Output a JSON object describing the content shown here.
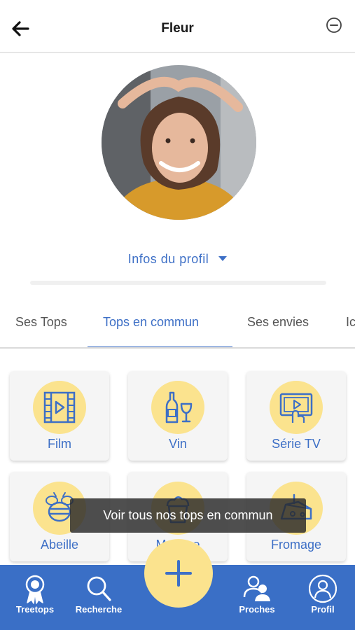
{
  "header": {
    "title": "Fleur",
    "back_icon": "arrow-left-icon",
    "remove_icon": "minus-circle-icon"
  },
  "profile": {
    "infos_label": "Infos du profil"
  },
  "tabs": [
    {
      "label": "Ses Tops",
      "active": false
    },
    {
      "label": "Tops en commun",
      "active": true
    },
    {
      "label": "Ses envies",
      "active": false
    },
    {
      "label": "Ic",
      "active": false
    }
  ],
  "categories": [
    {
      "label": "Film",
      "icon": "film-icon"
    },
    {
      "label": "Vin",
      "icon": "wine-icon"
    },
    {
      "label": "Série TV",
      "icon": "tv-series-icon"
    },
    {
      "label": "Abeille",
      "icon": "bee-icon"
    },
    {
      "label": "Mousse",
      "icon": "mousse-icon"
    },
    {
      "label": "Fromage",
      "icon": "cheese-icon"
    }
  ],
  "toast": {
    "text": "Voir tous nos tops en commun"
  },
  "bottom_nav": [
    {
      "label": "Treetops",
      "icon": "award-ribbon-icon"
    },
    {
      "label": "Recherche",
      "icon": "search-icon"
    },
    {
      "label": "Proches",
      "icon": "people-icon"
    },
    {
      "label": "Profil",
      "icon": "profile-icon"
    }
  ],
  "fab": {
    "icon": "plus-icon"
  },
  "colors": {
    "accent": "#3d6fc6",
    "nav_background": "#3a6fc6",
    "icon_circle": "#fbe38e",
    "card_background": "#f5f5f5"
  }
}
